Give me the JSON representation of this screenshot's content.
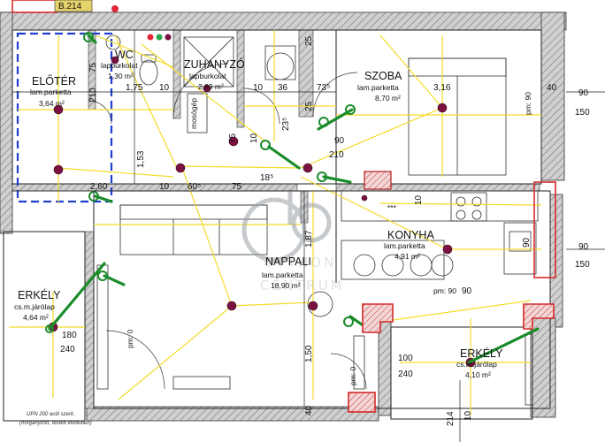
{
  "unit_tag": "B.214",
  "rooms": {
    "eloter": {
      "name": "ELŐTÉR",
      "floor": "lam.parketta",
      "area": "3,64 m²"
    },
    "wc": {
      "name": "WC",
      "floor": "lapburkolat",
      "area": "1,30 m²"
    },
    "zuhanyzo": {
      "name": "ZUHANYZÓ",
      "floor": "lapburkolat",
      "area": "2,89 m²"
    },
    "szoba": {
      "name": "SZOBA",
      "floor": "lam.parketta",
      "area": "8,70 m²"
    },
    "konyha": {
      "name": "KONYHA",
      "floor": "lam.parketta",
      "area": "4,91 m²"
    },
    "nappali": {
      "name": "NAPPALI",
      "floor": "lam.parketta",
      "area": "18,90 m²"
    },
    "erkely_left": {
      "name": "ERKÉLY",
      "floor": "cs.m.járólap",
      "area": "4,64 m²"
    },
    "erkely_right": {
      "name": "ERKÉLY",
      "floor": "cs.m.járólap",
      "area": "4,10 m²"
    }
  },
  "labels": {
    "mosogep": "mosógép",
    "kitchen_mark": "***",
    "corner_note_1": "UPN 200 acél szerk.",
    "corner_note_2": "(horganyzott, festett kivitelben)"
  },
  "watermark": {
    "line1": "OTTHON",
    "line2": "CENTRUM"
  },
  "dimensions": {
    "d75_a": "75",
    "d210_a": "210",
    "d175": "1,75",
    "d10_a": "10",
    "d10_b": "10",
    "d36": "36",
    "d73": "73⁵",
    "d316": "3,16",
    "d40": "40",
    "d90_a": "90",
    "d150_a": "150",
    "d90_b": "90",
    "d150_b": "150",
    "d25_a": "25",
    "d25_b": "25",
    "d23": "23⁵",
    "d90_c": "90",
    "d210_b": "210",
    "d75_b": "75",
    "d10_c": "10",
    "d153": "1,53",
    "d260": "2,60",
    "d10_d": "10",
    "d605": "60⁵",
    "d75_c": "75",
    "d185": "18⁵",
    "d10_e": "10",
    "d187": "1,87",
    "d90_d": "90",
    "d180": "180",
    "d240_a": "240",
    "d150_c": "1,50",
    "d100": "100",
    "d240_b": "240",
    "d214": "214",
    "d40_b": "40",
    "d10_f": "10",
    "d90_e": "90",
    "pm0_a": "pm: 0",
    "pm0_b": "pm: 0",
    "pm90_a": "pm: 90",
    "pm90_b": "pm: 90"
  },
  "colors": {
    "wall": "#8c8c8c",
    "wire": "#f2dc2a",
    "blue_zone": "#1f3fd1",
    "fixture": "#7a1140",
    "route": "#1a8c2a",
    "red_frame": "#d42a2a"
  }
}
